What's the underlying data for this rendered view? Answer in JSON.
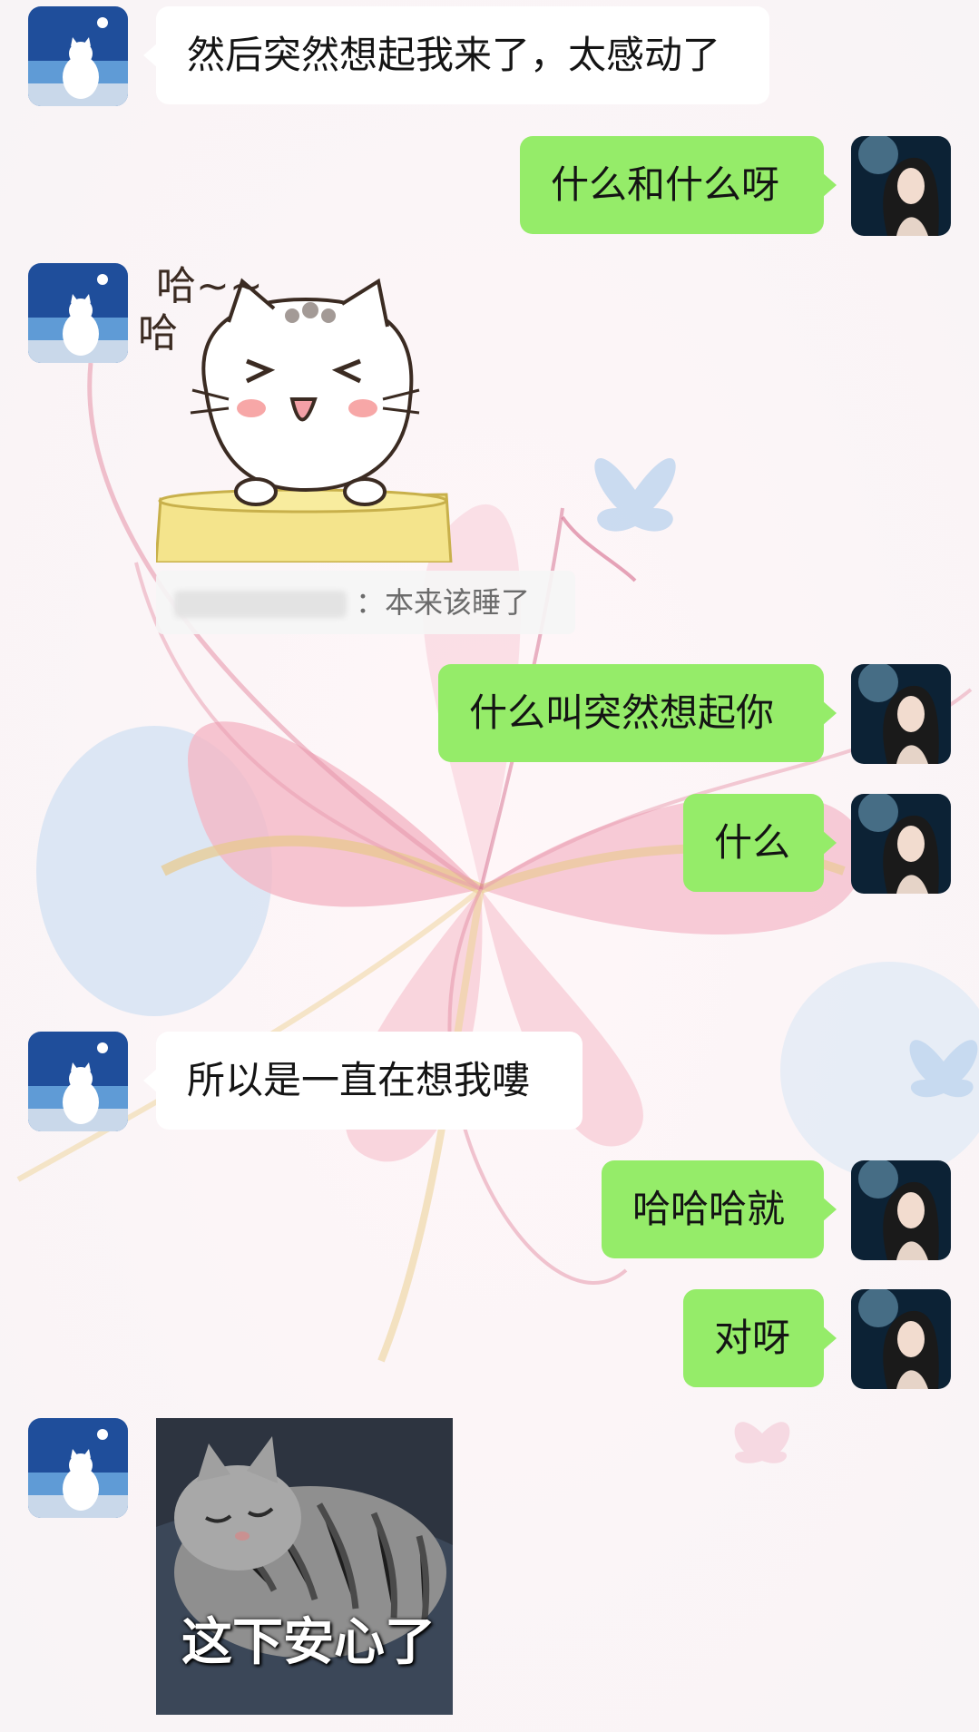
{
  "colors": {
    "outgoing_bubble": "#95ec69",
    "incoming_bubble": "#ffffff",
    "background": "#fbf7f8"
  },
  "icons": {
    "other_avatar": "white-cat-moonlight-avatar",
    "self_avatar": "girl-portrait-avatar"
  },
  "messages": [
    {
      "side": "left",
      "type": "text",
      "text": "然后突然想起我来了，太感动了"
    },
    {
      "side": "right",
      "type": "text",
      "text": "什么和什么呀"
    },
    {
      "side": "left",
      "type": "sticker",
      "sticker_text": "哈~~ 哈",
      "quote": {
        "text": "本来该睡了"
      }
    },
    {
      "side": "right",
      "type": "text",
      "text": "什么叫突然想起你"
    },
    {
      "side": "right",
      "type": "text",
      "text": "什么"
    },
    {
      "side": "left",
      "type": "text",
      "text": "所以是一直在想我嘍"
    },
    {
      "side": "right",
      "type": "text",
      "text": "哈哈哈就"
    },
    {
      "side": "right",
      "type": "text",
      "text": "对呀"
    },
    {
      "side": "left",
      "type": "sticker",
      "sticker_text": "这下安心了"
    }
  ],
  "quote_separator": "："
}
